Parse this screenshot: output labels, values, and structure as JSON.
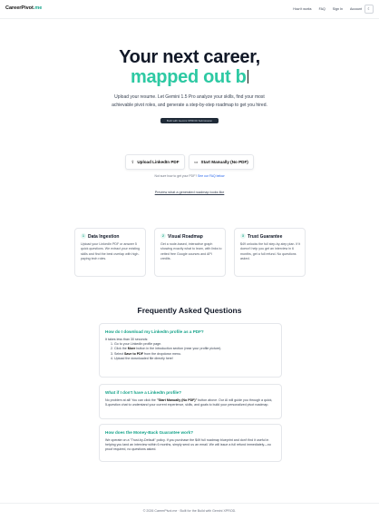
{
  "nav": {
    "logo_main": "CareerPivot",
    "logo_suffix": ".me",
    "links": [
      "How it works",
      "FAQ",
      "Sign In",
      "Account"
    ],
    "theme_icon": "moon-icon"
  },
  "hero": {
    "title_line1": "Your next career,",
    "title_line2": "mapped out b",
    "subtitle_line1": "Upload your resume. Let Gemini 1.5 Pro analyze your skills, find your most",
    "subtitle_line2": "achievable pivot roles, and generate a step-by-step roadmap to get you hired.",
    "badge": "Built with Gemini XPROD Submission"
  },
  "actions": {
    "upload_label": "Upload LinkedIn PDF",
    "upload_icon": "upload-icon",
    "manual_label": "Start Manually (No PDF)",
    "manual_icon": "chat-icon",
    "hint_text": "Not sure how to get your PDF?",
    "hint_link": "See our FAQ below",
    "preview_link": "Preview what a generated roadmap looks like"
  },
  "features": [
    {
      "num": "1",
      "title": "Data Ingestion",
      "desc": "Upload your LinkedIn PDF or answer 5 quick questions. We extract your existing skills and find the best overlap with high-paying tech roles."
    },
    {
      "num": "2",
      "title": "Visual Roadmap",
      "desc": "Get a node-based, interactive graph showing exactly what to learn, with links to vetted free Google courses and API credits."
    },
    {
      "num": "3",
      "title": "Trust Guarantee",
      "desc": "$49 unlocks the full step-by-step plan. If it doesn't help you get an interview in 6 months, get a full refund. No questions asked."
    }
  ],
  "faq": {
    "heading": "Frequently Asked Questions",
    "q1": "How do I download my LinkedIn profile as a PDF?",
    "q1_intro": "It takes less than 30 seconds:",
    "q1_steps": {
      "s1": "Go to your LinkedIn profile page.",
      "s2_pre": "Click the",
      "s2_bold": "More",
      "s2_post": "button in the introduction section (near your profile picture).",
      "s3_pre": "Select",
      "s3_bold": "Save to PDF",
      "s3_post": "from the dropdown menu.",
      "s4": "Upload the downloaded file directly here!"
    },
    "q2": "What if I don't have a LinkedIn profile?",
    "q2_pre": "No problem at all! You can click the",
    "q2_bold": "\"Start Manually (No PDF)\"",
    "q2_post": "button above. Our AI will guide you through a quick, 5-question chat to understand your current experience, skills, and goals to build your personalized pivot roadmap.",
    "q3": "How does the Money-Back Guarantee work?",
    "q3_answer": "We operate on a \"Trust-by-Default\" policy. If you purchase the $49 full roadmap blueprint and don't find it useful in helping you land an interview within 6 months, simply send us an email. We will issue a full refund immediately—no proof required, no questions asked."
  },
  "footer": {
    "text": "© 2026 CareerPivot.me · Built for the Build with Gemini XPROD."
  }
}
